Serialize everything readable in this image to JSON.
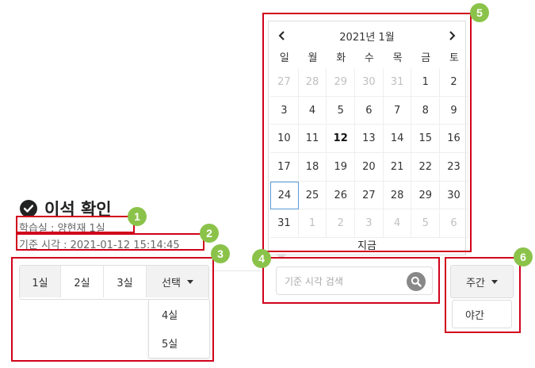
{
  "page": {
    "title": "이석 확인",
    "room_info": "학습실 : 양현재 1실",
    "base_time": "기준 시각 : 2021-01-12 15:14:45"
  },
  "room_buttons": [
    "1실",
    "2실",
    "3실"
  ],
  "room_select": {
    "label": "선택",
    "options": [
      "4실",
      "5실"
    ]
  },
  "search": {
    "placeholder": "기준 시각 검색"
  },
  "calendar": {
    "title": "2021년 1월",
    "weekdays": [
      "일",
      "월",
      "화",
      "수",
      "목",
      "금",
      "토"
    ],
    "days": [
      {
        "d": "27",
        "muted": true
      },
      {
        "d": "28",
        "muted": true
      },
      {
        "d": "29",
        "muted": true
      },
      {
        "d": "30",
        "muted": true
      },
      {
        "d": "31",
        "muted": true
      },
      {
        "d": "1"
      },
      {
        "d": "2"
      },
      {
        "d": "3"
      },
      {
        "d": "4"
      },
      {
        "d": "5"
      },
      {
        "d": "6"
      },
      {
        "d": "7"
      },
      {
        "d": "8"
      },
      {
        "d": "9"
      },
      {
        "d": "10"
      },
      {
        "d": "11"
      },
      {
        "d": "12",
        "today": true
      },
      {
        "d": "13"
      },
      {
        "d": "14"
      },
      {
        "d": "15"
      },
      {
        "d": "16"
      },
      {
        "d": "17"
      },
      {
        "d": "18"
      },
      {
        "d": "19"
      },
      {
        "d": "20"
      },
      {
        "d": "21"
      },
      {
        "d": "22"
      },
      {
        "d": "23"
      },
      {
        "d": "24",
        "selected": true
      },
      {
        "d": "25"
      },
      {
        "d": "26"
      },
      {
        "d": "27"
      },
      {
        "d": "28"
      },
      {
        "d": "29"
      },
      {
        "d": "30"
      },
      {
        "d": "31"
      },
      {
        "d": "1",
        "muted": true
      },
      {
        "d": "2",
        "muted": true
      },
      {
        "d": "3",
        "muted": true
      },
      {
        "d": "4",
        "muted": true
      },
      {
        "d": "5",
        "muted": true
      },
      {
        "d": "6",
        "muted": true
      }
    ],
    "today_label": "지금"
  },
  "period": {
    "label": "주간",
    "options": [
      "야간"
    ]
  },
  "annotations": [
    "1",
    "2",
    "3",
    "4",
    "5",
    "6"
  ],
  "colors": {
    "annotation_border": "#d0021b",
    "badge": "#8bc34a",
    "selected_border": "#5b9bd5"
  }
}
